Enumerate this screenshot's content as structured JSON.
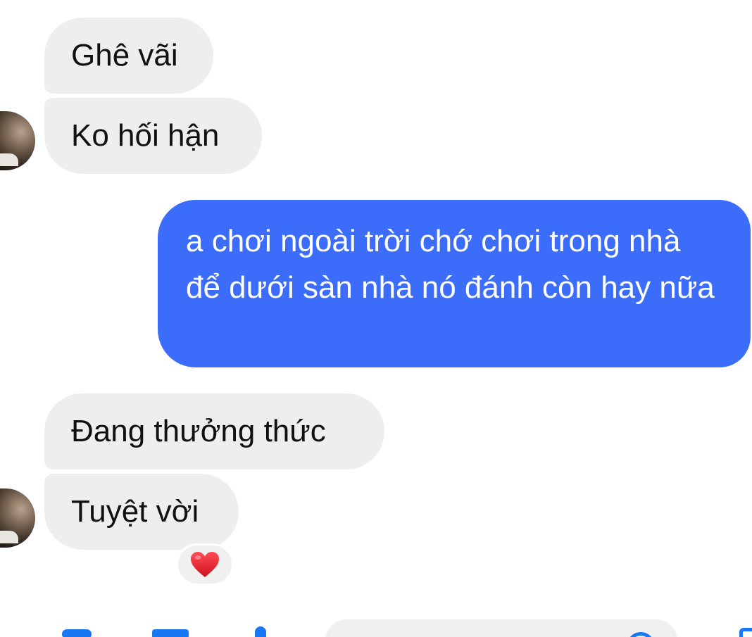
{
  "messages": [
    {
      "sender": "other",
      "text": "Ghê vãi"
    },
    {
      "sender": "other",
      "text": "Ko hối hận"
    },
    {
      "sender": "me",
      "text": "a chơi ngoài trời chớ chơi trong nhà để dưới sàn nhà nó đánh còn hay nữa"
    },
    {
      "sender": "other",
      "text": "Đang thưởng thức"
    },
    {
      "sender": "other",
      "text": "Tuyệt vời",
      "reaction": "heart"
    }
  ],
  "colors": {
    "outgoing_bubble": "#3c6cfa",
    "incoming_bubble": "#eeeeef",
    "accent": "#1877f2",
    "reaction_heart": "#e0202a"
  },
  "icons": {
    "reaction": "heart-icon",
    "composer": [
      "more-icon",
      "camera-icon",
      "mic-icon",
      "emoji-icon",
      "like-icon"
    ]
  }
}
